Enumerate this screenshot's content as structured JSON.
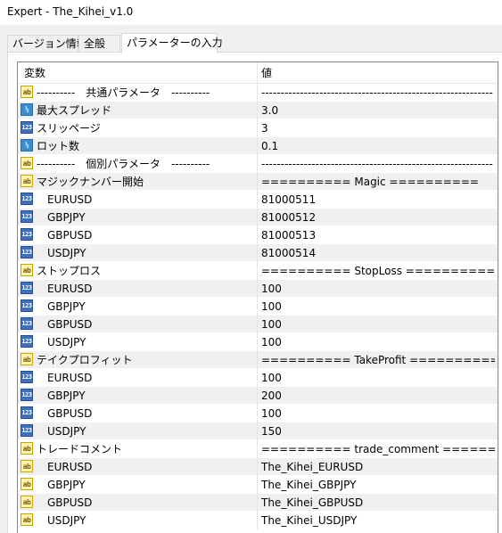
{
  "window": {
    "title": "Expert - The_Kihei_v1.0"
  },
  "tabs": [
    {
      "label": "バージョン情報"
    },
    {
      "label": "全般"
    },
    {
      "label": "パラメーターの入力"
    }
  ],
  "grid": {
    "headers": {
      "variable": "変数",
      "value": "値"
    },
    "rows": [
      {
        "icon": "ab",
        "name": "----------　共通パラメータ　----------",
        "value": "------------------------------------------------------------",
        "indent": false
      },
      {
        "icon": "dbl",
        "name": "最大スプレッド",
        "value": "3.0",
        "indent": false
      },
      {
        "icon": "num",
        "name": "スリッページ",
        "value": "3",
        "indent": false
      },
      {
        "icon": "dbl",
        "name": "ロット数",
        "value": "0.1",
        "indent": false
      },
      {
        "icon": "ab",
        "name": "----------　個別パラメータ　----------",
        "value": "------------------------------------------------------------",
        "indent": false
      },
      {
        "icon": "ab",
        "name": "マジックナンバー開始",
        "value": "========== Magic ==========",
        "indent": false
      },
      {
        "icon": "num",
        "name": "EURUSD",
        "value": "81000511",
        "indent": true
      },
      {
        "icon": "num",
        "name": "GBPJPY",
        "value": "81000512",
        "indent": true
      },
      {
        "icon": "num",
        "name": "GBPUSD",
        "value": "81000513",
        "indent": true
      },
      {
        "icon": "num",
        "name": "USDJPY",
        "value": "81000514",
        "indent": true
      },
      {
        "icon": "ab",
        "name": "ストップロス",
        "value": "========== StopLoss ==========",
        "indent": false
      },
      {
        "icon": "num",
        "name": "EURUSD",
        "value": "100",
        "indent": true
      },
      {
        "icon": "num",
        "name": "GBPJPY",
        "value": "100",
        "indent": true
      },
      {
        "icon": "num",
        "name": "GBPUSD",
        "value": "100",
        "indent": true
      },
      {
        "icon": "num",
        "name": "USDJPY",
        "value": "100",
        "indent": true
      },
      {
        "icon": "ab",
        "name": "テイクプロフィット",
        "value": "========== TakeProfit ==========",
        "indent": false
      },
      {
        "icon": "num",
        "name": "EURUSD",
        "value": "100",
        "indent": true
      },
      {
        "icon": "num",
        "name": "GBPJPY",
        "value": "200",
        "indent": true
      },
      {
        "icon": "num",
        "name": "GBPUSD",
        "value": "100",
        "indent": true
      },
      {
        "icon": "num",
        "name": "USDJPY",
        "value": "150",
        "indent": true
      },
      {
        "icon": "ab",
        "name": "トレードコメント",
        "value": "========== trade_comment ==========",
        "indent": false
      },
      {
        "icon": "ab",
        "name": "EURUSD",
        "value": "The_Kihei_EURUSD",
        "indent": true
      },
      {
        "icon": "ab",
        "name": "GBPJPY",
        "value": "The_Kihei_GBPJPY",
        "indent": true
      },
      {
        "icon": "ab",
        "name": "GBPUSD",
        "value": "The_Kihei_GBPUSD",
        "indent": true
      },
      {
        "icon": "ab",
        "name": "USDJPY",
        "value": "The_Kihei_USDJPY",
        "indent": true
      }
    ]
  },
  "icons": {
    "ab": {
      "name": "string-type-icon",
      "glyph": "ab",
      "color": "#fff3b0"
    },
    "num": {
      "name": "integer-type-icon",
      "glyph": "123",
      "color": "#3d6fbf"
    },
    "dbl": {
      "name": "double-type-icon",
      "glyph": "½",
      "color": "#3c8ed0"
    }
  }
}
